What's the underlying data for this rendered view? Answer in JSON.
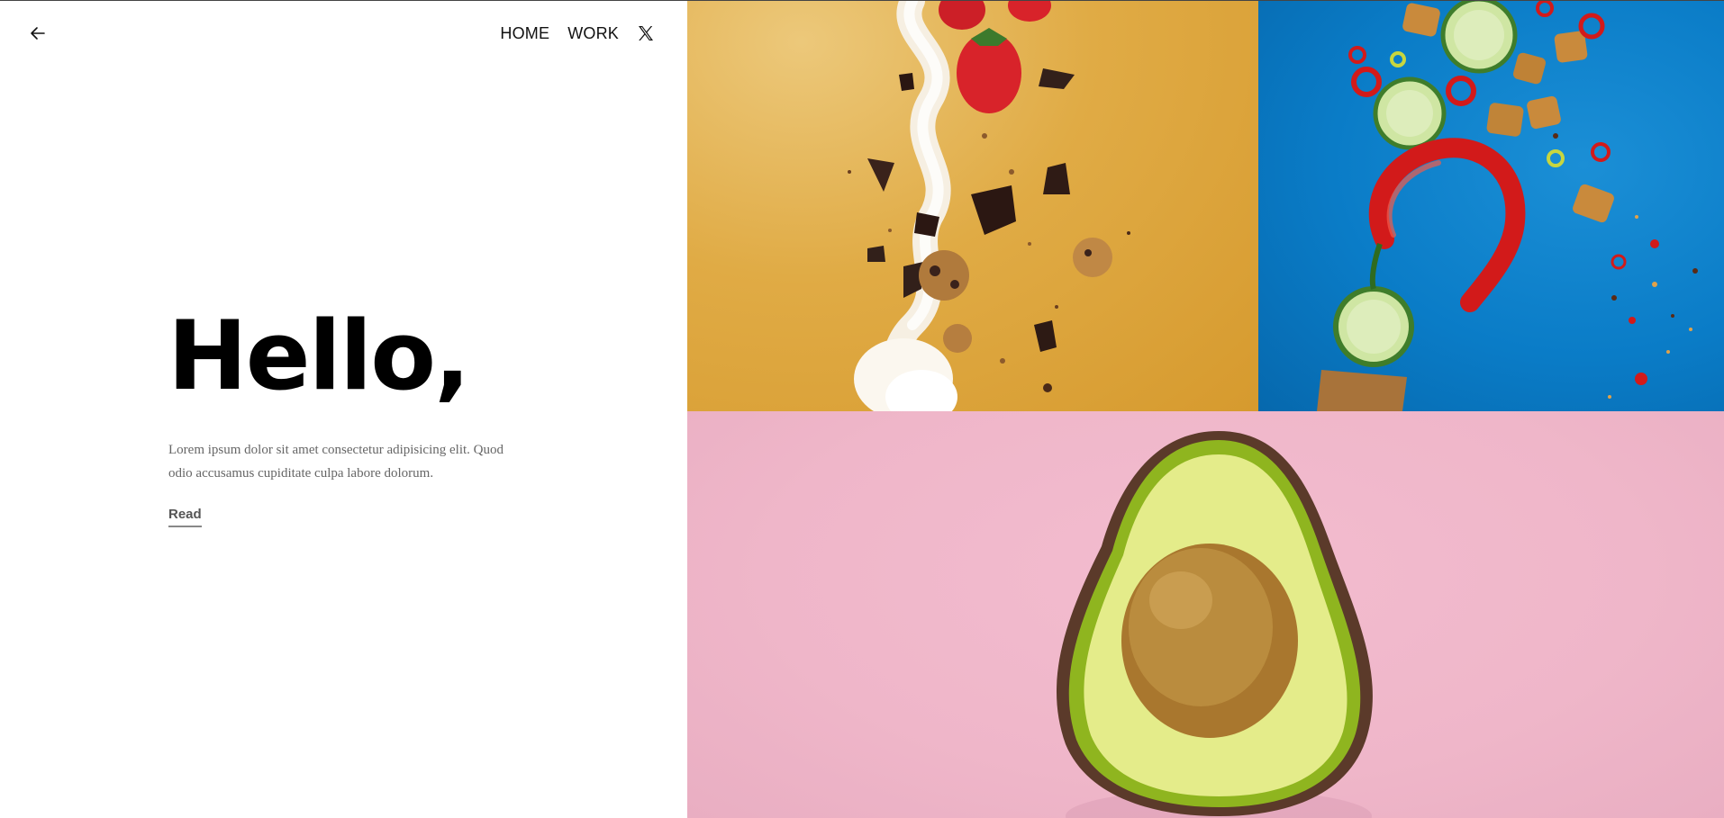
{
  "nav": {
    "back_icon": "arrow-left-icon",
    "links": [
      "HOME",
      "WORK"
    ],
    "social_icon": "x-twitter-icon"
  },
  "hero": {
    "title": "Hello,",
    "text": "Lorem ipsum dolor sit amet consectetur adipisicing elit. Quod odio accusamus cupiditate culpa labore dolorum.",
    "read_label": "Read"
  },
  "gallery": {
    "tiles": [
      {
        "subject": "flying dessert: cream, strawberry, chocolate, cookies",
        "background": "#e0ab45"
      },
      {
        "subject": "flying snack: cucumber, red chili, croutons",
        "background": "#0a7cc7"
      },
      {
        "subject": "halved avocado with pit",
        "background": "#efb6c9"
      }
    ]
  },
  "colors": {
    "text_primary": "#000000",
    "text_muted": "#666666",
    "link_underline": "#888888"
  }
}
